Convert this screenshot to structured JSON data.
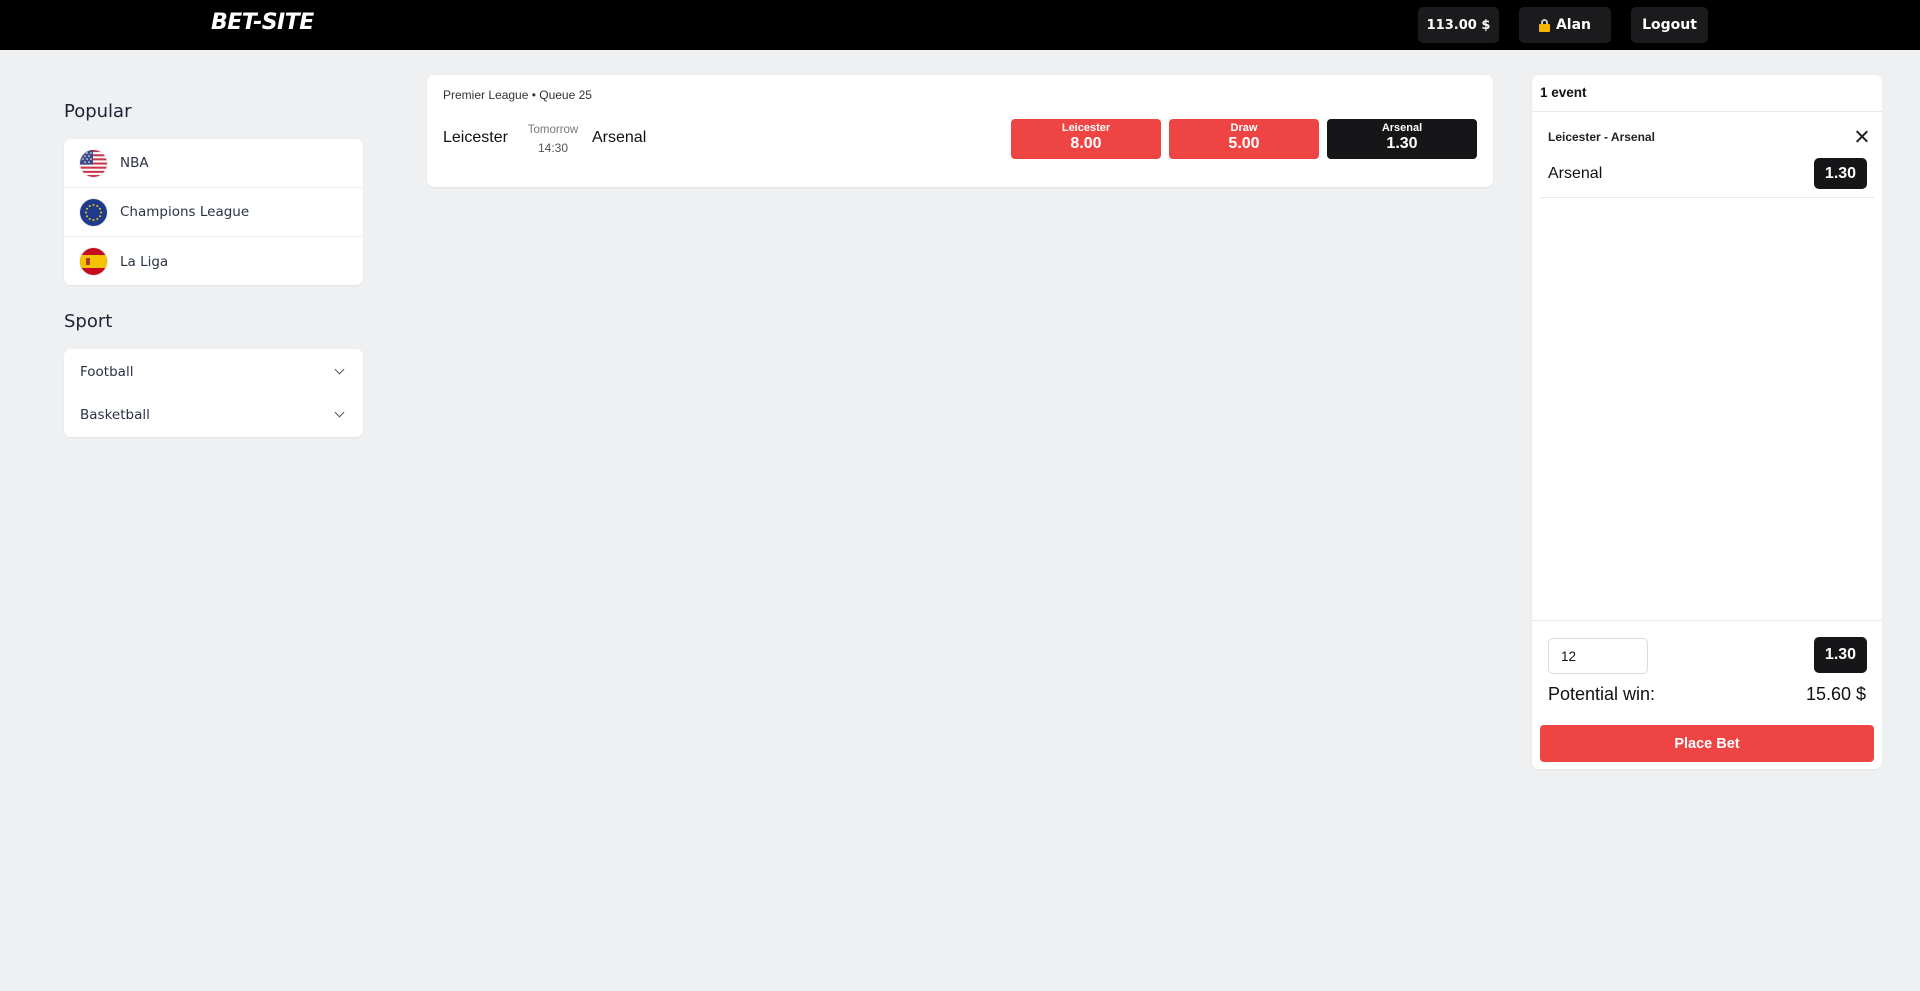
{
  "header": {
    "logo": "BET-SITE",
    "balance": "113.00 $",
    "user": {
      "name": "Alan",
      "icon": "lock-icon"
    },
    "logout_label": "Logout",
    "colors": {
      "background": "#000000",
      "button": "#1b1b1d"
    }
  },
  "sidebar": {
    "popular_title": "Popular",
    "popular": [
      {
        "label": "NBA",
        "icon": "us-flag-icon"
      },
      {
        "label": "Champions League",
        "icon": "eu-flag-icon"
      },
      {
        "label": "La Liga",
        "icon": "spain-flag-icon"
      }
    ],
    "sport_title": "Sport",
    "sports": [
      {
        "label": "Football",
        "icon": "chevron-down-icon"
      },
      {
        "label": "Basketball",
        "icon": "chevron-down-icon"
      }
    ]
  },
  "event": {
    "league": "Premier League • Queue 25",
    "home": "Leicester",
    "away": "Arsenal",
    "date": "Tomorrow",
    "time": "14:30",
    "odds": [
      {
        "label": "Leicester",
        "value": "8.00",
        "selected": false
      },
      {
        "label": "Draw",
        "value": "5.00",
        "selected": false
      },
      {
        "label": "Arsenal",
        "value": "1.30",
        "selected": true
      }
    ]
  },
  "betslip": {
    "count_label": "1 event",
    "match": "Leicester - Arsenal",
    "pick": "Arsenal",
    "pick_odd": "1.30",
    "stake": "12",
    "total_odd": "1.30",
    "potential_win_label": "Potential win:",
    "potential_win_value": "15.60 $",
    "place_bet_label": "Place Bet"
  },
  "colors": {
    "accent_red": "#ef4444",
    "dark": "#161618",
    "page_bg": "#eef0f2"
  }
}
